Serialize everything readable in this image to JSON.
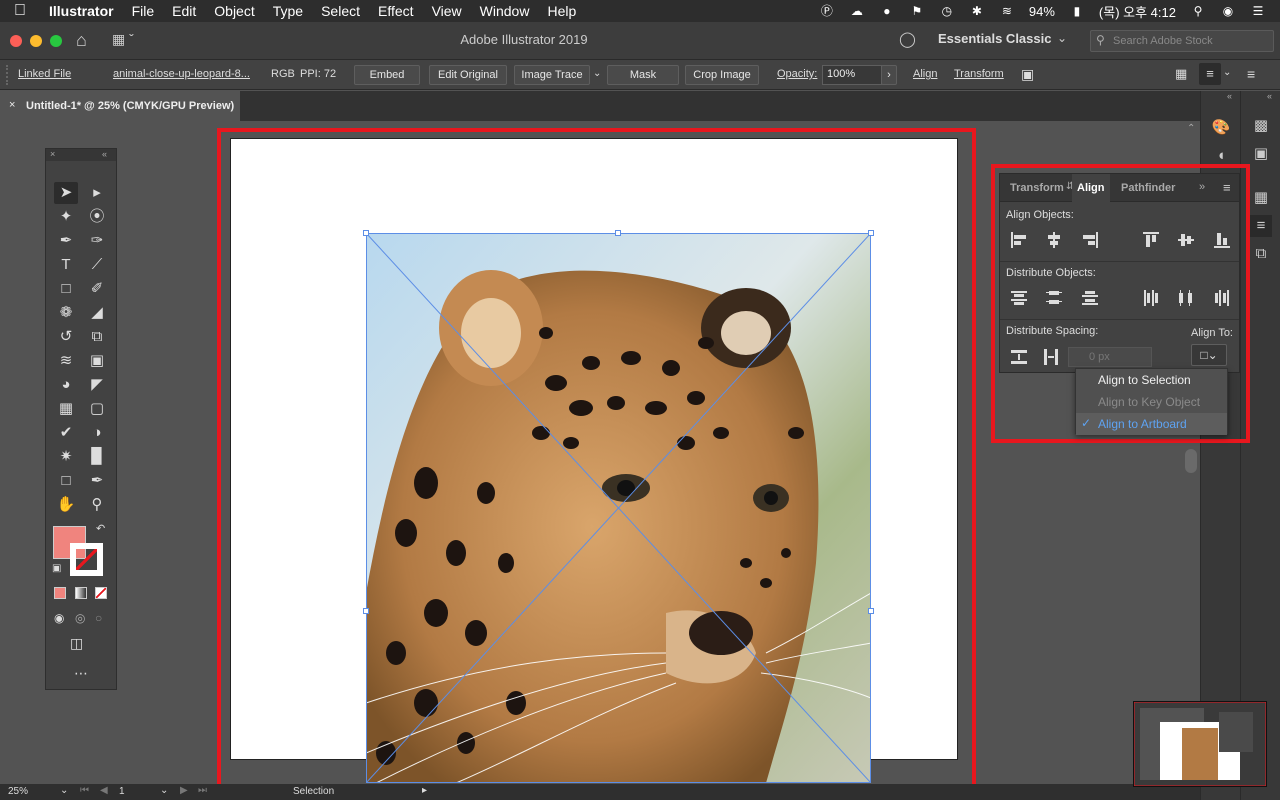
{
  "menubar": {
    "app": "Illustrator",
    "menus": [
      "File",
      "Edit",
      "Object",
      "Type",
      "Select",
      "Effect",
      "View",
      "Window",
      "Help"
    ],
    "battery": "94%",
    "datetime": "(목) 오후 4:12"
  },
  "titlebar": {
    "title": "Adobe Illustrator 2019",
    "workspace": "Essentials Classic",
    "search_placeholder": "Search Adobe Stock"
  },
  "controlbar": {
    "linked_file": "Linked File",
    "filename": "animal-close-up-leopard-8...",
    "color_mode": "RGB",
    "ppi": "PPI: 72",
    "embed": "Embed",
    "edit_original": "Edit Original",
    "image_trace": "Image Trace",
    "mask": "Mask",
    "crop_image": "Crop Image",
    "opacity_label": "Opacity:",
    "opacity_value": "100%",
    "align": "Align",
    "transform": "Transform"
  },
  "document": {
    "tab_title": "Untitled-1* @ 25% (CMYK/GPU Preview)"
  },
  "align_panel": {
    "tabs": [
      "Transform",
      "Align",
      "Pathfinder"
    ],
    "active_tab": "Align",
    "align_objects": "Align Objects:",
    "distribute_objects": "Distribute Objects:",
    "distribute_spacing": "Distribute Spacing:",
    "align_to": "Align To:",
    "spacing_value": "0 px"
  },
  "align_to_menu": {
    "items": [
      {
        "label": "Align to Selection",
        "enabled": true,
        "checked": false
      },
      {
        "label": "Align to Key Object",
        "enabled": false,
        "checked": false
      },
      {
        "label": "Align to Artboard",
        "enabled": true,
        "checked": true
      }
    ]
  },
  "statusbar": {
    "zoom": "25%",
    "artboard": "1",
    "tool": "Selection"
  },
  "colors": {
    "fill": "#f0847e",
    "highlight": "#e8171e",
    "accent": "#5ea3f2"
  }
}
